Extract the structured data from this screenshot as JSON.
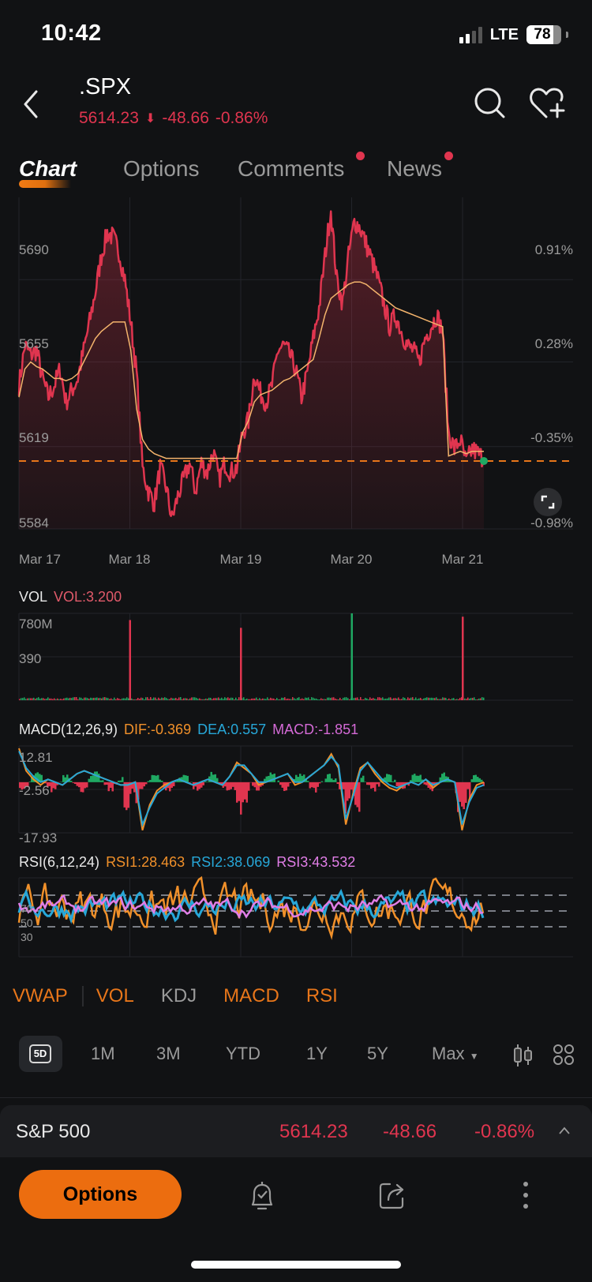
{
  "status_bar": {
    "time": "10:42",
    "network": "LTE",
    "battery": 78,
    "signal_bars_on": 2,
    "signal_bars_total": 4
  },
  "header": {
    "ticker": ".SPX",
    "price": "5614.23",
    "change": "-48.66",
    "change_pct": "-0.86%",
    "direction": "down"
  },
  "tabs": [
    {
      "label": "Chart",
      "active": true,
      "dot": false
    },
    {
      "label": "Options",
      "active": false,
      "dot": false
    },
    {
      "label": "Comments",
      "active": false,
      "dot": true
    },
    {
      "label": "News",
      "active": false,
      "dot": true
    }
  ],
  "colors": {
    "accent": "#ec6d0f",
    "down": "#e0354f",
    "up": "#1fa862",
    "vwap": "#f4b46c",
    "dif": "#f0902a",
    "dea": "#27a7d8",
    "macd": "#d46ad6",
    "rsi1": "#f0902a",
    "rsi2": "#27a7d8",
    "rsi3": "#e07ee6"
  },
  "volume_panel": {
    "label": "VOL",
    "value_label": "VOL:3.200"
  },
  "macd_panel": {
    "label": "MACD(12,26,9)",
    "dif": "DIF:-0.369",
    "dea": "DEA:0.557",
    "macd": "MACD:-1.851"
  },
  "rsi_panel": {
    "label": "RSI(6,12,24)",
    "rsi1": "RSI1:28.463",
    "rsi2": "RSI2:38.069",
    "rsi3": "RSI3:43.532"
  },
  "chart_data": [
    {
      "type": "area",
      "title": ".SPX 5D intraday",
      "x_ticks": [
        "Mar 17",
        "Mar 18",
        "Mar 19",
        "Mar 20",
        "Mar 21"
      ],
      "y_ticks": [
        "5690",
        "5655",
        "5619",
        "5584"
      ],
      "y_ticks_pct": [
        "0.91%",
        "0.28%",
        "-0.35%",
        "-0.98%"
      ],
      "ylim": [
        5584,
        5725
      ],
      "prev_close": 5614.23,
      "series": [
        {
          "name": "Price",
          "values": [
            5645,
            5662,
            5658,
            5660,
            5648,
            5640,
            5645,
            5652,
            5638,
            5643,
            5648,
            5660,
            5672,
            5685,
            5700,
            5710,
            5708,
            5702,
            5690,
            5672,
            5650,
            5610,
            5600,
            5595,
            5610,
            5602,
            5588,
            5598,
            5605,
            5612,
            5600,
            5612,
            5608,
            5617,
            5605,
            5612,
            5608,
            5610,
            5625,
            5630,
            5650,
            5642,
            5638,
            5645,
            5660,
            5662,
            5658,
            5652,
            5640,
            5650,
            5665,
            5678,
            5700,
            5720,
            5690,
            5680,
            5700,
            5715,
            5712,
            5705,
            5698,
            5690,
            5680,
            5670,
            5675,
            5668,
            5662,
            5660,
            5655,
            5665,
            5670,
            5675,
            5668,
            5625,
            5618,
            5622,
            5612,
            5618,
            5616,
            5614
          ]
        },
        {
          "name": "VWAP",
          "values": [
            5640,
            5652,
            5655,
            5653,
            5652,
            5650,
            5648,
            5648,
            5647,
            5648,
            5650,
            5655,
            5660,
            5665,
            5668,
            5670,
            5672,
            5672,
            5672,
            5660,
            5635,
            5622,
            5618,
            5616,
            5615,
            5614,
            5614,
            5614,
            5614,
            5614,
            5614,
            5614,
            5614,
            5614,
            5614,
            5614,
            5614,
            5614,
            5625,
            5630,
            5638,
            5641,
            5642,
            5643,
            5645,
            5647,
            5648,
            5650,
            5652,
            5654,
            5656,
            5665,
            5675,
            5682,
            5684,
            5686,
            5688,
            5689,
            5689,
            5688,
            5686,
            5684,
            5682,
            5680,
            5678,
            5677,
            5676,
            5675,
            5674,
            5673,
            5672,
            5671,
            5670,
            5615,
            5616,
            5617,
            5616,
            5617,
            5617,
            5617
          ]
        }
      ]
    },
    {
      "type": "bar",
      "title": "Volume",
      "y_ticks": [
        "780M",
        "390"
      ],
      "ylim": [
        0,
        780
      ],
      "spikes": [
        {
          "session": "Mar 18 open",
          "value": 720,
          "color": "down"
        },
        {
          "session": "Mar 19 open",
          "value": 650,
          "color": "down"
        },
        {
          "session": "Mar 20 open",
          "value": 780,
          "color": "up"
        },
        {
          "session": "Mar 21 open",
          "value": 750,
          "color": "down"
        }
      ]
    },
    {
      "type": "line",
      "title": "MACD(12,26,9)",
      "y_ticks": [
        "12.81",
        "-2.56",
        "-17.93"
      ],
      "ylim": [
        -17.93,
        12.81
      ],
      "series": [
        {
          "name": "DIF",
          "values": [
            12,
            4,
            1,
            -1,
            1,
            0,
            -1,
            1,
            3,
            4,
            3,
            2,
            1,
            0,
            -1,
            -1,
            0,
            -17,
            -8,
            -3,
            -1,
            0,
            1,
            0,
            -1,
            0,
            1,
            0,
            -1,
            2,
            7,
            5,
            3,
            -1,
            0,
            1,
            2,
            3,
            -1,
            0,
            2,
            4,
            6,
            10,
            5,
            -15,
            -4,
            5,
            7,
            3,
            0,
            -2,
            -3,
            -1,
            0,
            -1,
            1,
            -2,
            0,
            1,
            0,
            -17,
            -6,
            -1,
            0
          ]
        },
        {
          "name": "DEA",
          "values": [
            11,
            5,
            2,
            0,
            1,
            0,
            -1,
            1,
            3,
            4,
            3,
            2,
            1,
            0,
            -1,
            -1,
            0,
            -15,
            -9,
            -4,
            -2,
            0,
            1,
            0,
            -1,
            0,
            1,
            0,
            -1,
            2,
            6,
            6,
            3,
            0,
            0,
            1,
            2,
            3,
            0,
            0,
            2,
            4,
            6,
            9,
            6,
            -13,
            -5,
            4,
            7,
            4,
            1,
            -1,
            -2,
            -1,
            0,
            -1,
            1,
            -1,
            0,
            1,
            0,
            -15,
            -7,
            -2,
            -1
          ]
        }
      ],
      "histogram_note": "green above zero, red below zero"
    },
    {
      "type": "line",
      "title": "RSI(6,12,24)",
      "y_ticks": [
        "70",
        "50",
        "30"
      ],
      "ylim": [
        0,
        100
      ],
      "reference_lines": [
        70,
        50,
        30
      ],
      "series": [
        {
          "name": "RSI1",
          "last": 28.463
        },
        {
          "name": "RSI2",
          "last": 38.069
        },
        {
          "name": "RSI3",
          "last": 43.532
        }
      ]
    }
  ],
  "indicator_toggles": [
    {
      "label": "VWAP",
      "active": true
    },
    {
      "label": "VOL",
      "active": true
    },
    {
      "label": "KDJ",
      "active": false
    },
    {
      "label": "MACD",
      "active": true
    },
    {
      "label": "RSI",
      "active": true
    }
  ],
  "periods": [
    {
      "label": "5D",
      "active": true
    },
    {
      "label": "1M",
      "active": false
    },
    {
      "label": "3M",
      "active": false
    },
    {
      "label": "YTD",
      "active": false
    },
    {
      "label": "1Y",
      "active": false
    },
    {
      "label": "5Y",
      "active": false
    },
    {
      "label": "Max",
      "active": false
    }
  ],
  "summary": {
    "name": "S&P 500",
    "price": "5614.23",
    "change": "-48.66",
    "change_pct": "-0.86%"
  },
  "bottom_bar": {
    "options_label": "Options"
  }
}
